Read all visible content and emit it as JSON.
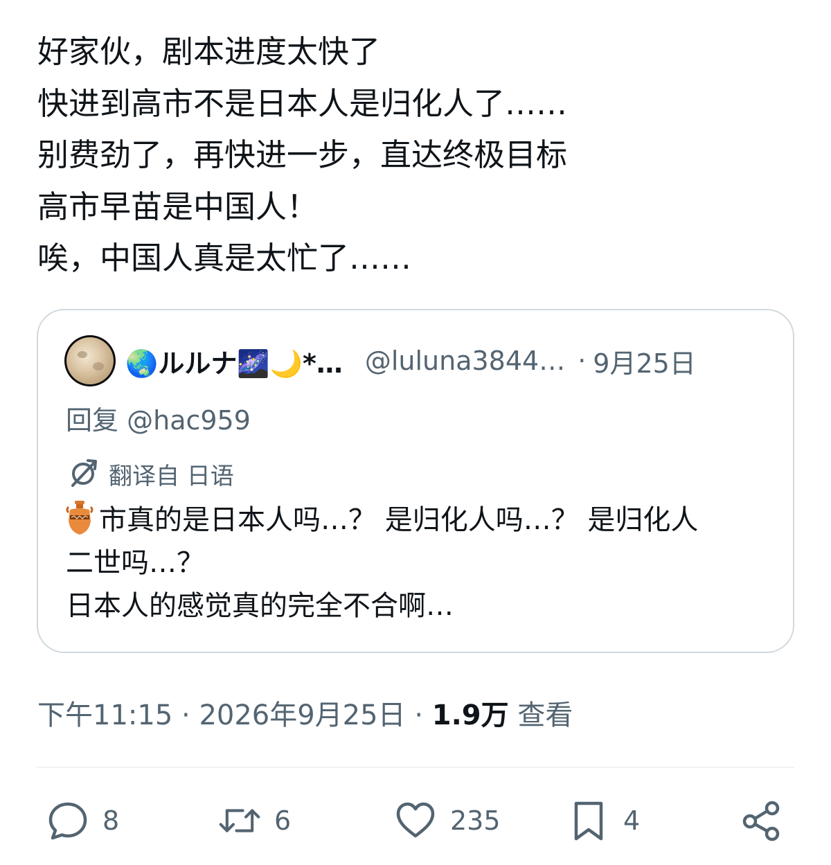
{
  "tweet": {
    "lines": [
      "好家伙，剧本进度太快了",
      "快进到高市不是日本人是归化人了……",
      "别费劲了，再快进一步，直达终极目标",
      "高市早苗是中国人！",
      "唉，中国人真是太忙了……"
    ]
  },
  "quote": {
    "author_name": "🌏ルルナ🌌🌙*…",
    "handle": "@luluna3844…",
    "date": "9月25日",
    "reply_prefix": "回复",
    "reply_handle": "@hac959",
    "translate_label": "翻译自 日语",
    "body_lines": [
      "市真的是日本人吗…？ 是归化人吗…？ 是归化人",
      "二世吗…？",
      "日本人的感觉真的完全不合啊…"
    ]
  },
  "meta": {
    "time": "下午11:15",
    "date": "2026年9月25日",
    "views_count": "1.9万",
    "views_label": "查看"
  },
  "actions": {
    "reply_count": "8",
    "retweet_count": "6",
    "like_count": "235",
    "bookmark_count": "4"
  },
  "icons": [
    "avatar-moon",
    "translate-icon",
    "vase-emoji",
    "reply-icon",
    "retweet-icon",
    "like-icon",
    "bookmark-icon",
    "share-icon"
  ],
  "colors": {
    "text": "#0f1419",
    "secondary": "#536471",
    "border": "#cfd9de",
    "divider": "#eff3f4"
  }
}
